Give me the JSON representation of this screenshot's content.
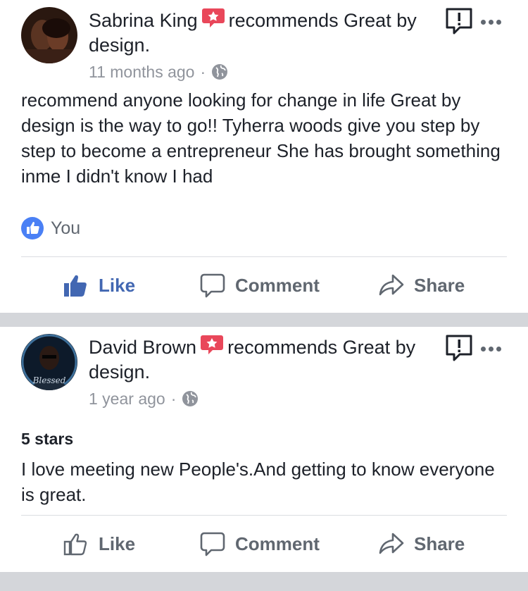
{
  "posts": [
    {
      "author": "Sabrina King",
      "action_text": "recommends Great by design.",
      "time": "11 months ago",
      "separator": "·",
      "rating": "",
      "body": "recommend anyone looking for change in life Great by design is the way to go!! Tyherra woods give you step by step to become a entrepreneur She has brought something inme I didn't know I had",
      "reactions_text": "You",
      "liked": true
    },
    {
      "author": "David Brown",
      "action_text": "recommends Great by design.",
      "time": "1 year ago",
      "separator": "·",
      "rating": "5 stars",
      "body": "I love meeting new People's.And getting to know everyone is great.",
      "reactions_text": "",
      "liked": false
    }
  ],
  "actions": {
    "like_label": "Like",
    "comment_label": "Comment",
    "share_label": "Share"
  },
  "icons": {
    "recommend": "recommend-star-bubble-icon",
    "report": "report-exclamation-icon",
    "more": "more-dots-icon",
    "globe": "globe-icon",
    "like": "thumbs-up-icon",
    "comment": "comment-bubble-icon",
    "share": "share-arrow-icon"
  },
  "colors": {
    "accent": "#4267b2",
    "recommend_red": "#e9475a",
    "meta_gray": "#90949c",
    "band_gray": "#d4d6da"
  }
}
